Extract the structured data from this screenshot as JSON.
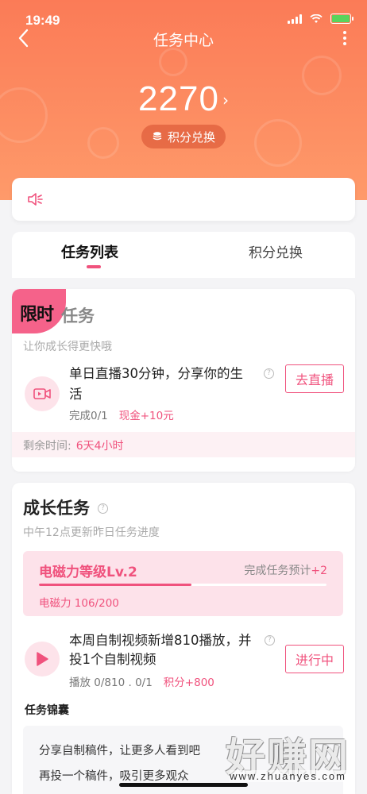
{
  "status_bar": {
    "time": "19:49"
  },
  "nav": {
    "title": "任务中心"
  },
  "points": {
    "value": "2270",
    "arrow": "›",
    "exchange_label": "积分兑换"
  },
  "tabs": {
    "active": "任务列表",
    "inactive": "积分兑换"
  },
  "limited": {
    "badge": "限时",
    "title": "任务",
    "subtitle": "让你成长得更快哦",
    "task": {
      "title_line1": "单日直播30分钟，分享你的生",
      "title_line2": "活",
      "progress": "完成0/1",
      "reward": "现金+10元",
      "action": "去直播"
    },
    "remaining_label": "剩余时间:",
    "remaining_value": "6天4小时"
  },
  "growth": {
    "title": "成长任务",
    "subtitle": "中午12点更新昨日任务进度",
    "level": {
      "name": "电磁力等级Lv.2",
      "hint_label": "完成任务预计",
      "hint_value": "+2",
      "meta": "电磁力 106/200",
      "progress_fraction": 0.53
    },
    "task": {
      "title_line1": "本周自制视频新增810播放，并",
      "title_line2": "投1个自制视频",
      "progress": "播放 0/810 . 0/1",
      "reward": "积分+800",
      "action": "进行中"
    },
    "kit_label": "任务锦囊",
    "kit_lines": [
      "分享自制稿件，让更多人看到吧",
      "再投一个稿件，吸引更多观众"
    ]
  },
  "watermark": {
    "main": "好赚网",
    "url": "www.zhuanyes.com"
  },
  "colors": {
    "accent": "#f0527d",
    "header_top": "#fb7b57",
    "header_bottom": "#fe9a6a"
  }
}
